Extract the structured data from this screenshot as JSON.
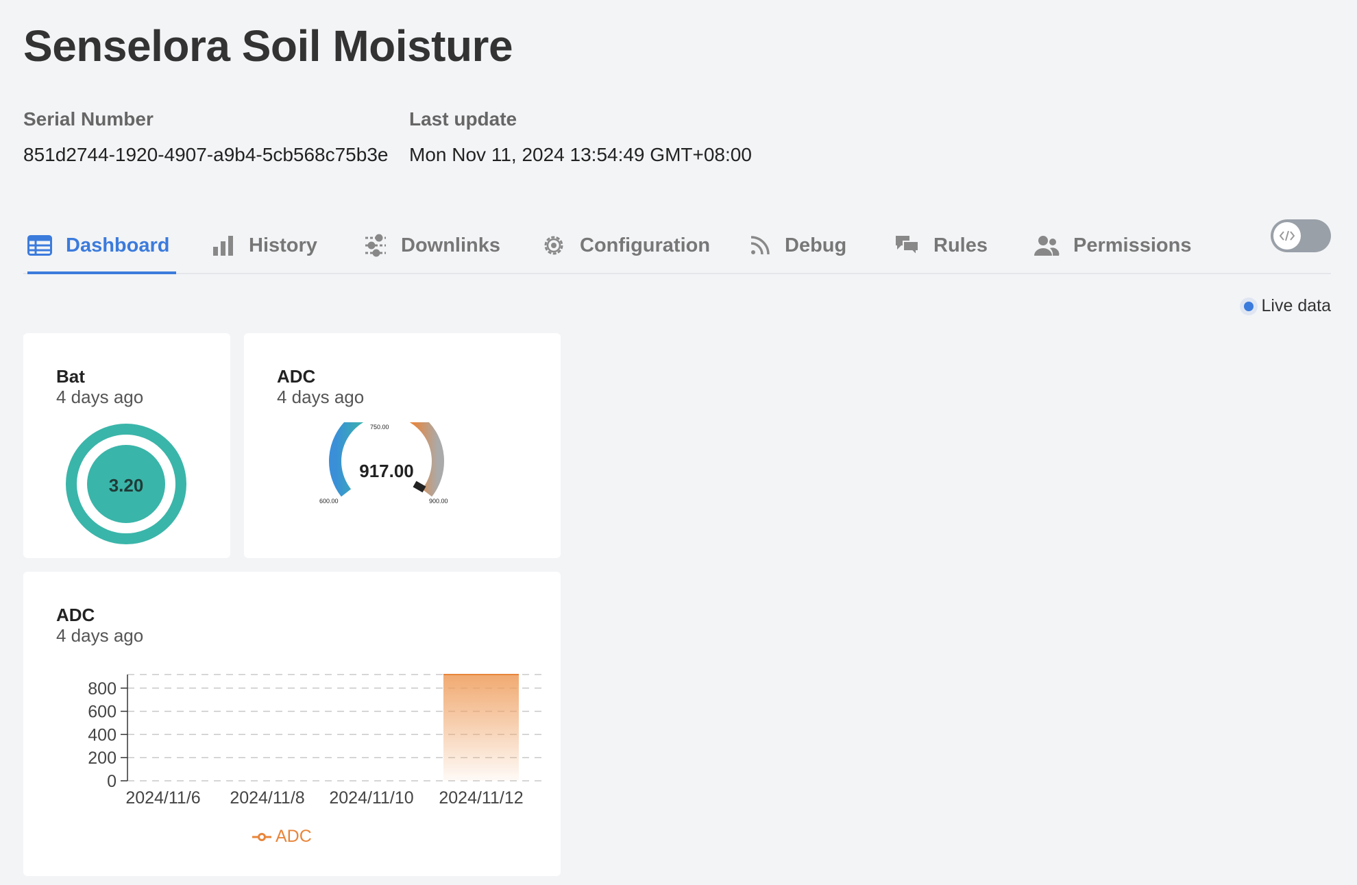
{
  "header": {
    "title": "Senselora Soil Moisture",
    "serial_label": "Serial Number",
    "serial_value": "851d2744-1920-4907-a9b4-5cb568c75b3e",
    "update_label": "Last update",
    "update_value": "Mon Nov 11, 2024 13:54:49 GMT+08:00"
  },
  "tabs": [
    {
      "label": "Dashboard",
      "icon": "table-icon",
      "active": true
    },
    {
      "label": "History",
      "icon": "bar-chart-icon"
    },
    {
      "label": "Downlinks",
      "icon": "sliders-icon"
    },
    {
      "label": "Configuration",
      "icon": "gear-icon"
    },
    {
      "label": "Debug",
      "icon": "rss-icon"
    },
    {
      "label": "Rules",
      "icon": "chat-icon"
    },
    {
      "label": "Permissions",
      "icon": "users-icon"
    }
  ],
  "live_label": "Live data",
  "colors": {
    "accent": "#3b7bdc",
    "teal": "#3ab5a9",
    "orange": "#e8853a"
  },
  "cards": {
    "bat": {
      "title": "Bat",
      "sub": "4 days ago",
      "value": "3.20"
    },
    "adc_gauge": {
      "title": "ADC",
      "sub": "4 days ago",
      "value": "917.00",
      "min_label": "600.00",
      "mid_label": "750.00",
      "max_label": "900.00"
    },
    "adc_chart": {
      "title": "ADC",
      "sub": "4 days ago"
    }
  },
  "chart_data": {
    "type": "bar",
    "x": [
      "2024/11/6",
      "2024/11/8",
      "2024/11/10",
      "2024/11/12"
    ],
    "ylim": [
      0,
      917
    ],
    "yticks": [
      "800",
      "600",
      "400",
      "200",
      "0"
    ],
    "grid": true,
    "legend": "bottom",
    "series": [
      {
        "name": "ADC",
        "values": [
          917
        ]
      }
    ]
  }
}
